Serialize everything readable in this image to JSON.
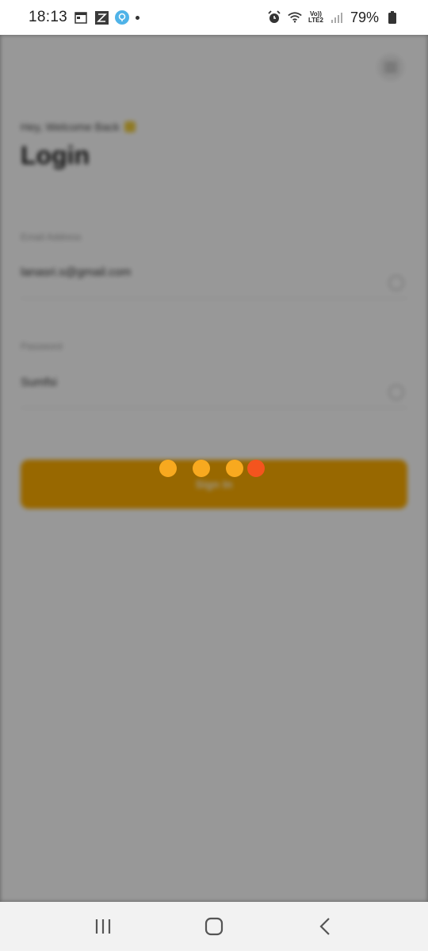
{
  "status_bar": {
    "time": "18:13",
    "battery": "79%",
    "lte_top": "Vo))",
    "lte_bottom": "LTE2"
  },
  "login": {
    "greeting": "Hey, Welcome Back",
    "title": "Login",
    "email_label": "Email Address",
    "email_value": "lanasri.s@gmail.com",
    "password_label": "Password",
    "password_value": "Sumfsi",
    "button_label": "Sign In"
  },
  "colors": {
    "accent": "#f5a800",
    "loader_dot": "#f8a91f",
    "loader_dot_active": "#f4541e"
  }
}
